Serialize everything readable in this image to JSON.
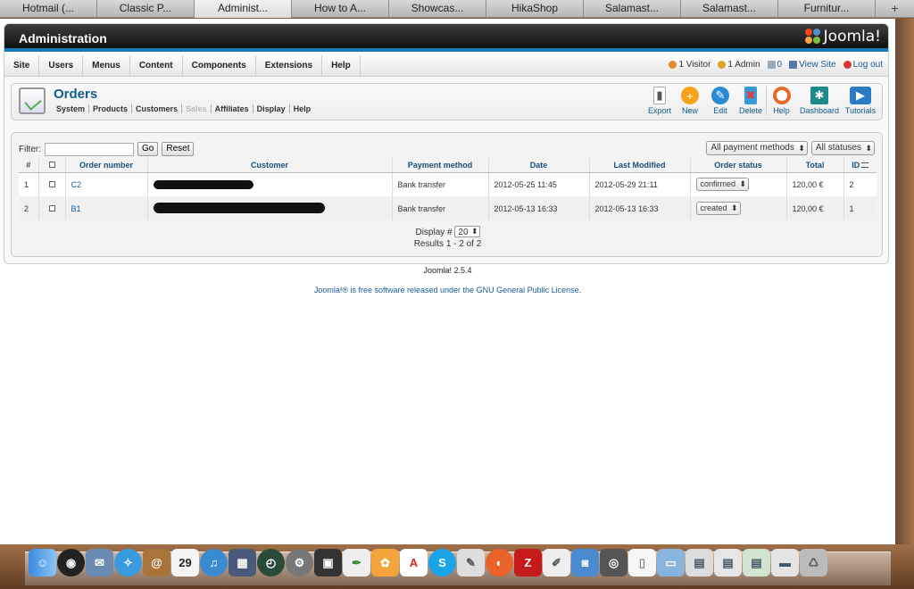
{
  "browser_tabs": [
    "Hotmail (...",
    "Classic P...",
    "Administ...",
    "How to A...",
    "Showcas...",
    "HikaShop",
    "Salamast...",
    "Salamast...",
    "Furnitur..."
  ],
  "active_tab_index": 2,
  "header": {
    "title": "Administration",
    "logo_text": "Joomla!"
  },
  "main_menu": [
    "Site",
    "Users",
    "Menus",
    "Content",
    "Components",
    "Extensions",
    "Help"
  ],
  "status": {
    "visitors": "1 Visitor",
    "admins": "1 Admin",
    "messages": "0",
    "view_site": "View Site",
    "logout": "Log out"
  },
  "page": {
    "title": "Orders",
    "submenu": [
      {
        "label": "System",
        "disabled": false
      },
      {
        "label": "Products",
        "disabled": false
      },
      {
        "label": "Customers",
        "disabled": false
      },
      {
        "label": "Sales",
        "disabled": true
      },
      {
        "label": "Affiliates",
        "disabled": false
      },
      {
        "label": "Display",
        "disabled": false
      },
      {
        "label": "Help",
        "disabled": false
      }
    ]
  },
  "toolbar": {
    "export": "Export",
    "new": "New",
    "edit": "Edit",
    "delete": "Delete",
    "help": "Help",
    "dashboard": "Dashboard",
    "tutorials": "Tutorials"
  },
  "filter": {
    "label": "Filter:",
    "value": "",
    "go": "Go",
    "reset": "Reset",
    "payment_select": "All payment methods",
    "status_select": "All statuses"
  },
  "table": {
    "headers": {
      "num": "#",
      "order_number": "Order number",
      "customer": "Customer",
      "payment": "Payment method",
      "date": "Date",
      "modified": "Last Modified",
      "status": "Order status",
      "total": "Total",
      "id": "ID"
    },
    "rows": [
      {
        "num": "1",
        "order_number": "C2",
        "payment": "Bank transfer",
        "date": "2012-05-25 11:45",
        "modified": "2012-05-29 21:11",
        "status": "confirmed",
        "total": "120,00 €",
        "id": "2"
      },
      {
        "num": "2",
        "order_number": "B1",
        "payment": "Bank transfer",
        "date": "2012-05-13 16:33",
        "modified": "2012-05-13 16:33",
        "status": "created",
        "total": "120,00 €",
        "id": "1"
      }
    ]
  },
  "pager": {
    "display_label": "Display #",
    "display_value": "20",
    "results": "Results 1 - 2 of 2"
  },
  "footer": {
    "version": "Joomla! 2.5.4",
    "license_prefix": "Joomla!® is free software released under the",
    "license_link": "GNU General Public License",
    "license_suffix": "."
  },
  "colors": {
    "accent": "#1a7bb9",
    "link": "#1a5a99",
    "title": "#135d8e"
  }
}
